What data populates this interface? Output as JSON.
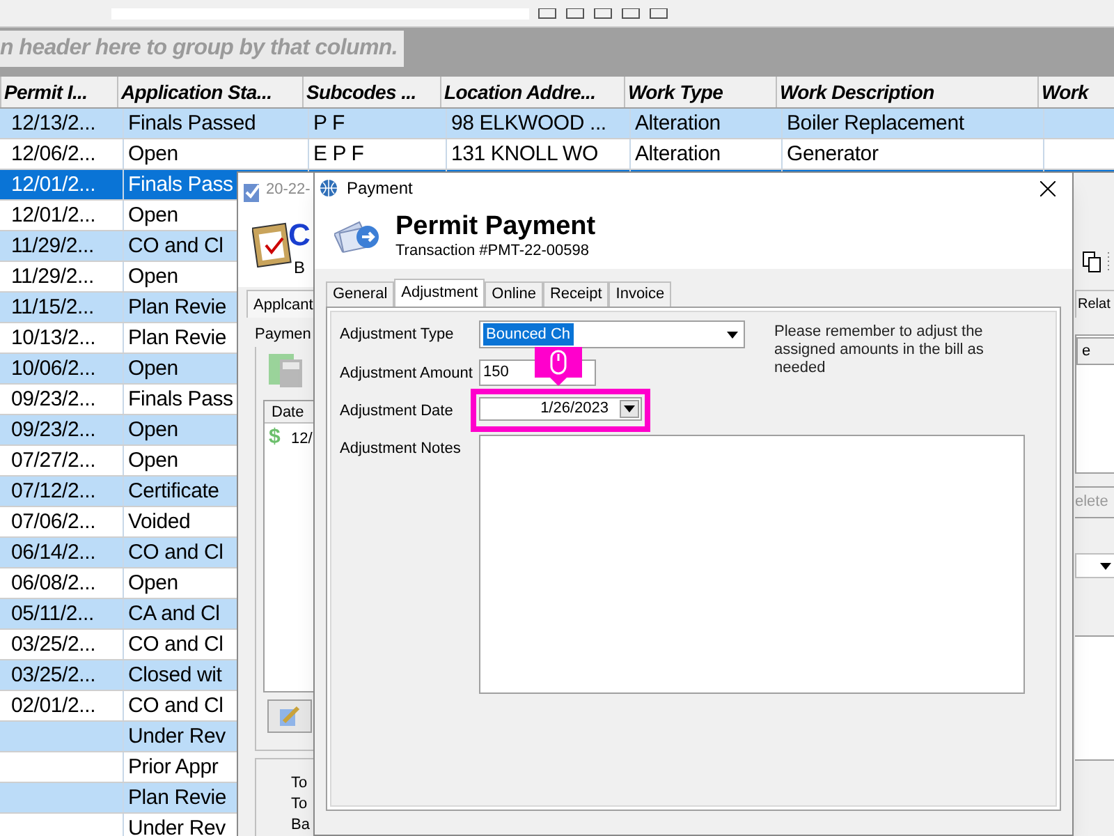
{
  "group_panel": {
    "hint": "n header here to group by that column."
  },
  "grid": {
    "columns": [
      "Permit I...",
      "Application Sta...",
      "Subcodes ...",
      "Location Addre...",
      "Work Type",
      "Work Description",
      "Work"
    ],
    "rows": [
      {
        "selected": false,
        "cells": [
          "12/13/2...",
          "Finals Passed",
          "P F",
          "98 ELKWOOD ...",
          "Alteration",
          "Boiler Replacement"
        ]
      },
      {
        "selected": false,
        "cells": [
          "12/06/2...",
          "Open",
          "E P F",
          "131 KNOLL WO",
          "Alteration",
          "Generator"
        ]
      },
      {
        "selected": true,
        "cells": [
          "12/01/2...",
          "Finals Pass"
        ]
      },
      {
        "selected": false,
        "cells": [
          "12/01/2...",
          "Open"
        ]
      },
      {
        "selected": false,
        "cells": [
          "11/29/2...",
          "CO and Cl"
        ]
      },
      {
        "selected": false,
        "cells": [
          "11/29/2...",
          "Open"
        ]
      },
      {
        "selected": false,
        "cells": [
          "11/15/2...",
          "Plan Revie"
        ]
      },
      {
        "selected": false,
        "cells": [
          "10/13/2...",
          "Plan Revie"
        ]
      },
      {
        "selected": false,
        "cells": [
          "10/06/2...",
          "Open"
        ]
      },
      {
        "selected": false,
        "cells": [
          "09/23/2...",
          "Finals Pass"
        ]
      },
      {
        "selected": false,
        "cells": [
          "09/23/2...",
          "Open"
        ]
      },
      {
        "selected": false,
        "cells": [
          "07/27/2...",
          "Open"
        ]
      },
      {
        "selected": false,
        "cells": [
          "07/12/2...",
          "Certificate"
        ]
      },
      {
        "selected": false,
        "cells": [
          "07/06/2...",
          "Voided"
        ]
      },
      {
        "selected": false,
        "cells": [
          "06/14/2...",
          "CO and Cl"
        ]
      },
      {
        "selected": false,
        "cells": [
          "06/08/2...",
          "Open"
        ]
      },
      {
        "selected": false,
        "cells": [
          "05/11/2...",
          "CA and Cl"
        ]
      },
      {
        "selected": false,
        "cells": [
          "03/25/2...",
          "CO and Cl"
        ]
      },
      {
        "selected": false,
        "cells": [
          "03/25/2...",
          "Closed wit"
        ]
      },
      {
        "selected": false,
        "cells": [
          "02/01/2...",
          "CO and Cl"
        ]
      },
      {
        "selected": false,
        "cells": [
          null,
          "Under Rev"
        ]
      },
      {
        "selected": false,
        "cells": [
          null,
          "Prior Appr"
        ]
      },
      {
        "selected": false,
        "cells": [
          null,
          "Plan Revie"
        ]
      },
      {
        "selected": false,
        "cells": [
          null,
          "Under Rev"
        ]
      }
    ]
  },
  "record_window": {
    "title": "20-22-",
    "heading": "C",
    "subheading": "B",
    "tab": "Applcant",
    "payments": {
      "title": "Paymen",
      "column": "Date",
      "symbol": "$",
      "row": "12/"
    },
    "totals": [
      "To",
      "To",
      "Ba"
    ],
    "right_tab": "Relat",
    "right_column": "e",
    "delete_button": "elete"
  },
  "payment_dialog": {
    "title": "Payment",
    "heading": "Permit Payment",
    "subheading": "Transaction #PMT-22-00598",
    "tabs": [
      {
        "label": "General",
        "selected": false
      },
      {
        "label": "Adjustment",
        "selected": true
      },
      {
        "label": "Online",
        "selected": false
      },
      {
        "label": "Receipt",
        "selected": false
      },
      {
        "label": "Invoice",
        "selected": false
      }
    ],
    "fields": [
      {
        "kind": "select",
        "label": "Adjustment Type",
        "value": "Bounced Ch",
        "selected": true,
        "highlighted": false
      },
      {
        "kind": "text",
        "label": "Adjustment Amount",
        "value": "150",
        "highlighted": false
      },
      {
        "kind": "date",
        "label": "Adjustment Date",
        "value": "1/26/2023",
        "highlighted": true
      },
      {
        "kind": "textarea",
        "label": "Adjustment Notes",
        "highlighted": false
      }
    ],
    "note": "Please remember to adjust the assigned amounts in the bill as needed"
  }
}
